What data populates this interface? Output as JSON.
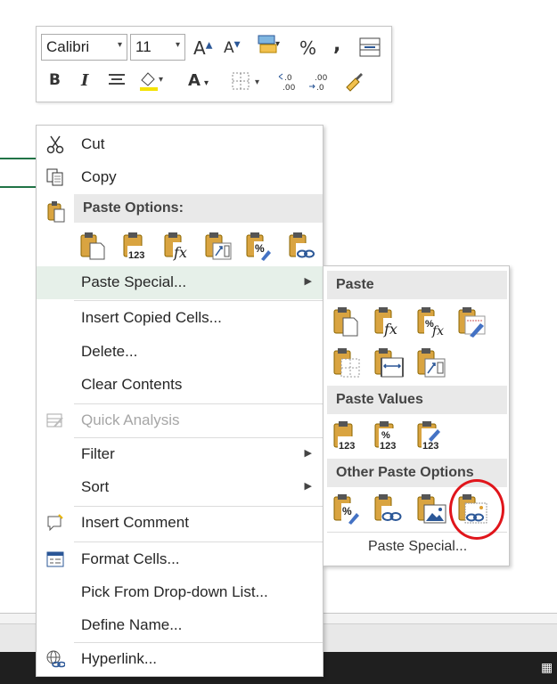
{
  "toolbar": {
    "font_name": "Calibri",
    "font_size": "11",
    "grow_font": "A",
    "shrink_font": "A",
    "percent": "%",
    "comma": ",",
    "bold": "B",
    "italic": "I",
    "font_color": "A",
    "dec_inc": "←.0 .00",
    "dec_dec": ".00 →.0"
  },
  "menu": {
    "cut": "Cut",
    "copy": "Copy",
    "paste_options_header": "Paste Options:",
    "paste_special": "Paste Special...",
    "insert_copied_cells": "Insert Copied Cells...",
    "delete": "Delete...",
    "clear_contents": "Clear Contents",
    "quick_analysis": "Quick Analysis",
    "filter": "Filter",
    "sort": "Sort",
    "insert_comment": "Insert Comment",
    "format_cells": "Format Cells...",
    "pick_from_dropdown": "Pick From Drop-down List...",
    "define_name": "Define Name...",
    "hyperlink": "Hyperlink..."
  },
  "submenu": {
    "paste_header": "Paste",
    "paste_values_header": "Paste Values",
    "other_paste_header": "Other Paste Options",
    "paste_special_link": "Paste Special..."
  },
  "icon_labels": {
    "values": "123",
    "formula": "fx",
    "percent": "%"
  },
  "colors": {
    "accent_green": "#217346",
    "highlight": "#e6f0e9",
    "section_bg": "#e9e9e9",
    "clipboard": "#d9a441",
    "circle_red": "#e0151b"
  }
}
